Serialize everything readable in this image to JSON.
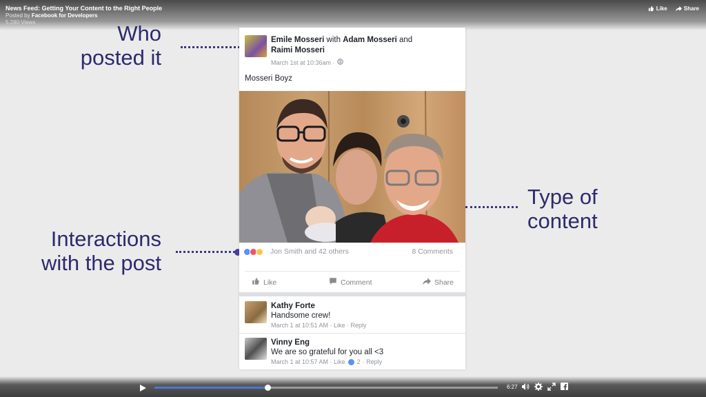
{
  "video": {
    "title": "News Feed: Getting Your Content to the Right People",
    "posted_prefix": "Posted by",
    "posted_by": "Facebook for Developers",
    "views": "5,280 Views",
    "like_label": "Like",
    "share_label": "Share",
    "progress": 0.33,
    "time": "6:27"
  },
  "annotations": {
    "who_line1": "Who",
    "who_line2": "posted it",
    "interactions_line1": "Interactions",
    "interactions_line2": "with the post",
    "type_line1": "Type of",
    "type_line2": "content"
  },
  "post": {
    "author": "Emile Mosseri",
    "with_word": "with",
    "tag1": "Adam Mosseri",
    "and_word": "and",
    "tag2": "Raimi Mosseri",
    "time": "March 1st at 10:36am ·",
    "text": "Mosseri Boyz",
    "reactions_text": "Jon Smith and 42 others",
    "comments_count": "8 Comments",
    "like_label": "Like",
    "comment_label": "Comment",
    "share_label": "Share"
  },
  "comments": [
    {
      "name": "Kathy Forte",
      "text": "Handsome crew!",
      "meta": "March 1 at 10:51 AM · Like · Reply"
    },
    {
      "name": "Vinny Eng",
      "text": "We are so grateful for you all <3",
      "meta_time": "March 1 at 10:57 AM · Like",
      "like_count": "2",
      "meta_reply": "· Reply"
    }
  ],
  "colors": {
    "annotation": "#2d2a6e",
    "dot": "#4a3fa0",
    "fb_blue": "#5890ff",
    "progress": "#4a76d8"
  }
}
